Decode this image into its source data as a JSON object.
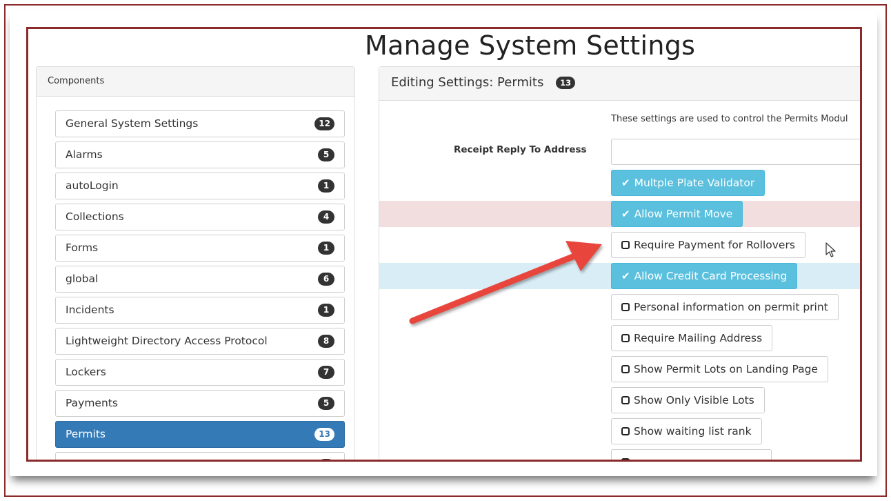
{
  "page": {
    "title": "Manage System Settings"
  },
  "components": {
    "header": "Components",
    "items": [
      {
        "label": "General System Settings",
        "count": "12",
        "active": false
      },
      {
        "label": "Alarms",
        "count": "5",
        "active": false
      },
      {
        "label": "autoLogin",
        "count": "1",
        "active": false
      },
      {
        "label": "Collections",
        "count": "4",
        "active": false
      },
      {
        "label": "Forms",
        "count": "1",
        "active": false
      },
      {
        "label": "global",
        "count": "6",
        "active": false
      },
      {
        "label": "Incidents",
        "count": "1",
        "active": false
      },
      {
        "label": "Lightweight Directory Access Protocol",
        "count": "8",
        "active": false
      },
      {
        "label": "Lockers",
        "count": "7",
        "active": false
      },
      {
        "label": "Payments",
        "count": "5",
        "active": false
      },
      {
        "label": "Permits",
        "count": "13",
        "active": true
      }
    ]
  },
  "settings": {
    "header": "Editing Settings: Permits",
    "count": "13",
    "description": "These settings are used to control the Permits Modul",
    "reply_label": "Receipt Reply To Address",
    "reply_value": "",
    "toggles": [
      {
        "label": "Multple Plate Validator",
        "checked": true,
        "check_glyph": "✔"
      },
      {
        "label": "Allow Permit Move",
        "checked": true,
        "check_glyph": "✔"
      },
      {
        "label": "Require Payment for Rollovers",
        "checked": false
      },
      {
        "label": "Allow Credit Card Processing",
        "checked": true,
        "check_glyph": "✔"
      },
      {
        "label": "Personal information on permit print",
        "checked": false
      },
      {
        "label": "Require Mailing Address",
        "checked": false
      },
      {
        "label": "Show Permit Lots on Landing Page",
        "checked": false
      },
      {
        "label": "Show Only Visible Lots",
        "checked": false
      },
      {
        "label": "Show waiting list rank",
        "checked": false
      }
    ]
  },
  "colors": {
    "frame": "#8b2a2a",
    "primary": "#337ab7",
    "info": "#5bc0de",
    "danger_row": "#f2dede",
    "info_row": "#d9edf7",
    "arrow": "#e8453c"
  }
}
